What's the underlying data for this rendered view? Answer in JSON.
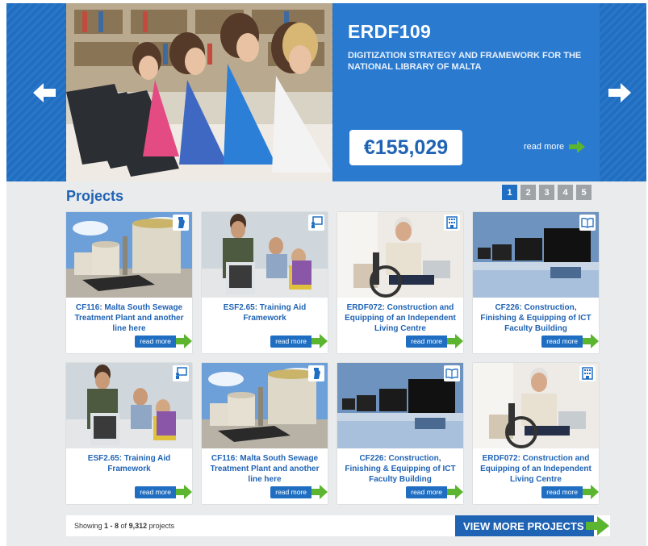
{
  "hero": {
    "title": "ERDF109",
    "subtitle": "DIGITIZATION STRATEGY AND FRAMEWORK FOR THE NATIONAL LIBRARY OF MALTA",
    "amount": "€155,029",
    "read_more": "read more"
  },
  "projects": {
    "title": "Projects",
    "pages": [
      "1",
      "2",
      "3",
      "4",
      "5"
    ],
    "active_page": "1",
    "cards": [
      {
        "title": "CF116: Malta South Sewage Treatment Plant and another line here",
        "image": "treatment-plant",
        "category_icon": "bottle-icon",
        "read_more": "read more"
      },
      {
        "title": "ESF2.65: Training Aid Framework",
        "image": "training-class",
        "category_icon": "training-icon",
        "read_more": "read more"
      },
      {
        "title": "ERDF072: Construction and Equipping of an Independent Living Centre",
        "image": "wheelchair-user",
        "category_icon": "building-icon",
        "read_more": "read more"
      },
      {
        "title": "CF226: Construction, Finishing & Equipping of ICT Faculty Building",
        "image": "computer-lab",
        "category_icon": "book-icon",
        "read_more": "read more"
      },
      {
        "title": "ESF2.65: Training Aid Framework",
        "image": "training-class",
        "category_icon": "training-icon",
        "read_more": "read more"
      },
      {
        "title": "CF116: Malta South Sewage Treatment Plant and another line here",
        "image": "treatment-plant",
        "category_icon": "bottle-icon",
        "read_more": "read more"
      },
      {
        "title": "CF226: Construction, Finishing & Equipping of ICT Faculty Building",
        "image": "computer-lab",
        "category_icon": "book-icon",
        "read_more": "read more"
      },
      {
        "title": "ERDF072: Construction and Equipping of an Independent Living Centre",
        "image": "wheelchair-user",
        "category_icon": "building-icon",
        "read_more": "read more"
      }
    ]
  },
  "footer": {
    "showing_prefix": "Showing ",
    "range": "1 - 8",
    "of": " of ",
    "total": "9,312",
    "suffix": " projects",
    "view_more": "VIEW MORE PROJECTS"
  },
  "colors": {
    "brand_blue": "#1f6ec2",
    "accent_green": "#5bb52f",
    "page_bg": "#e9ebec"
  }
}
